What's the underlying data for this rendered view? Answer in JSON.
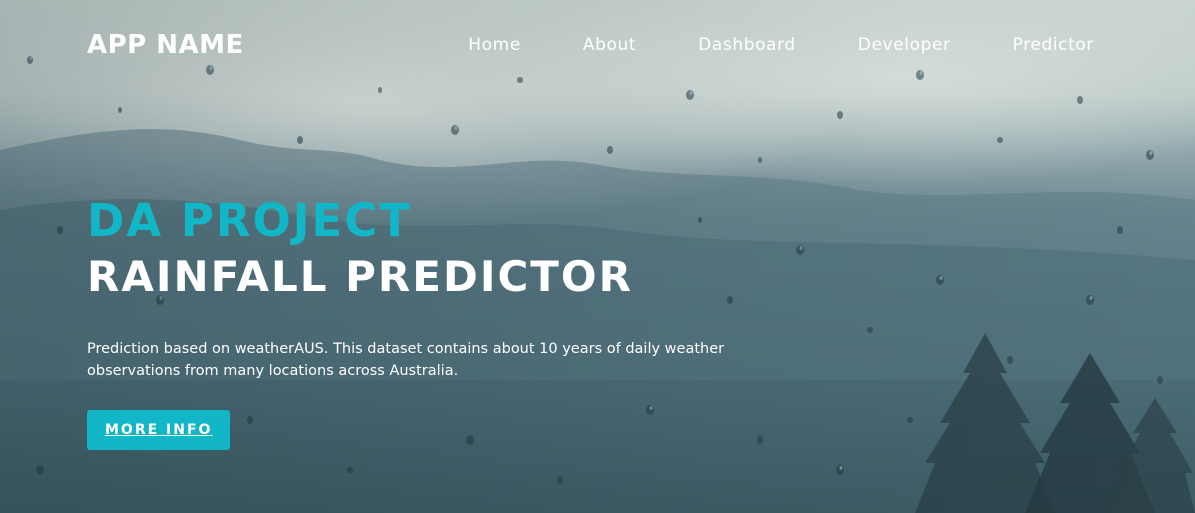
{
  "brand": {
    "name": "APP NAME"
  },
  "nav": {
    "items": [
      {
        "label": "Home"
      },
      {
        "label": "About"
      },
      {
        "label": "Dashboard"
      },
      {
        "label": "Developer"
      },
      {
        "label": "Predictor"
      }
    ]
  },
  "hero": {
    "title_accent": "DA PROJECT",
    "title_main": "RAINFALL PREDICTOR",
    "description": "Prediction based on weatherAUS. This dataset contains about 10 years of daily weather observations from many locations across Australia.",
    "cta_label": "MORE INFO"
  },
  "colors": {
    "accent": "#12b7c7",
    "text": "#ffffff"
  }
}
